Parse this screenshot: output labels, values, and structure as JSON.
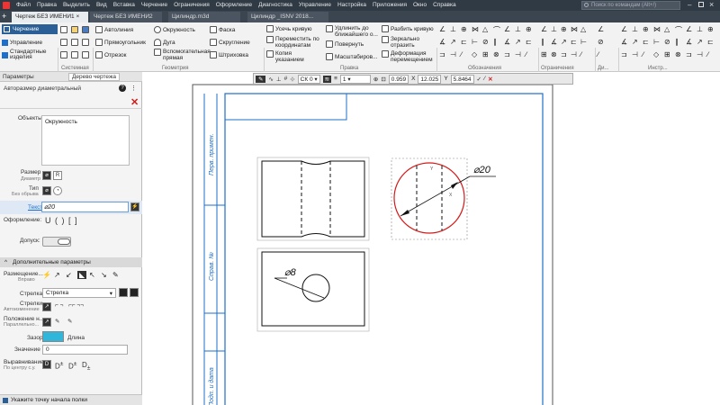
{
  "titlebar": {
    "menu": [
      "Файл",
      "Правка",
      "Выделить",
      "Вид",
      "Вставка",
      "Черчение",
      "Ограничения",
      "Оформление",
      "Диагностика",
      "Управление",
      "Настройка",
      "Приложения",
      "Окно",
      "Справка"
    ],
    "search_placeholder": "Поиск по командам (Alt+/)"
  },
  "tabs": [
    "Чертеж БЕЗ ИМЕНИ1",
    "Чертеж БЕЗ ИМЕНИ2",
    "Цилиндр.m3d",
    "Цилиндр _ISNV 2018..."
  ],
  "ribbon": {
    "mode": "Черчение",
    "left_items": [
      "Управление",
      "Стандартные изделия"
    ],
    "geometry": [
      "Автолиния",
      "Прямоугольник",
      "Отрезок",
      "Окружность",
      "Дуга",
      "Вспомогательная прямая",
      "Фаска",
      "Скругление",
      "Штриховка"
    ],
    "edit": [
      "Усечь кривую",
      "Переместить по координатам",
      "Копия указанием",
      "Удлинить до ближайшего о...",
      "Повернуть",
      "Масштабиров...",
      "Разбить кривую",
      "Зеркально отразить",
      "Деформация перемещением"
    ],
    "groups": [
      "Системная",
      "Геометрия",
      "Правка",
      "Обозначения",
      "Ограничения",
      "Ди...",
      "Инстр..."
    ]
  },
  "panel": {
    "header": "Параметры",
    "tab2": "Дерево чертежа",
    "subtitle": "Авторазмер диаметральный",
    "objects_label": "Объекты:",
    "objects_value": "Окружность",
    "size_label": "Размер",
    "size_sub": "Диаметр",
    "type_label": "Тип",
    "type_sub": "Без обрыва",
    "text_label": "Текст",
    "text_value": "⌀20",
    "format_label": "Оформление:",
    "format_value": "U ( ) [ ]",
    "tolerance_label": "Допуск:",
    "extra_header": "Дополнительные параметры",
    "placement_label": "Размещение...",
    "placement_sub": "Вправо",
    "arrow_label": "Стрелка",
    "arrow_value": "Стрелка",
    "arrows_label": "Стрелки",
    "arrows_sub": "Автоизменение",
    "position_label": "Положение н...",
    "position_sub": "Параллельно...",
    "gap_label": "Зазор",
    "gap_sub": "Длина",
    "value_label": "Значение",
    "value_value": "0",
    "align_label": "Выравнивание",
    "align_sub": "По центру с.у.",
    "status": "Укажите точку начала полки"
  },
  "floatbar": {
    "cs": "СК 0",
    "layer": "1",
    "zoom": "0.959",
    "x_label": "X",
    "x_value": "12.025",
    "y_label": "Y",
    "y_value": "5.8464"
  },
  "drawing": {
    "stamp": [
      "Перв. примен.",
      "Справ. №",
      "Подп. и дата"
    ],
    "dim_large": "⌀20",
    "dim_small": "⌀8"
  }
}
